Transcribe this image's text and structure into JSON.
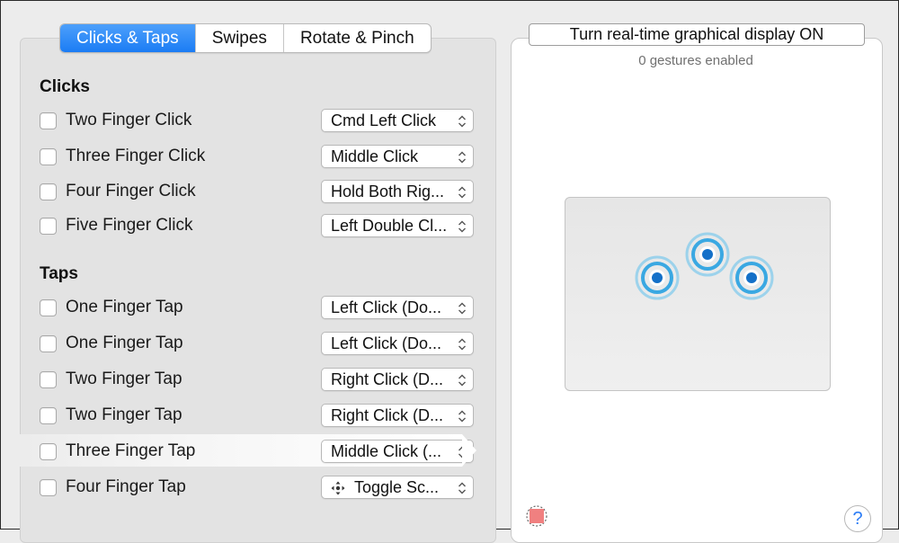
{
  "tabs": [
    {
      "label": "Clicks & Taps",
      "active": true
    },
    {
      "label": "Swipes",
      "active": false
    },
    {
      "label": "Rotate & Pinch",
      "active": false
    }
  ],
  "sections": {
    "clicks_title": "Clicks",
    "taps_title": "Taps"
  },
  "clicks": [
    {
      "label": "Two Finger Click",
      "action": "Cmd Left Click",
      "checked": false
    },
    {
      "label": "Three Finger Click",
      "action": "Middle Click",
      "checked": false
    },
    {
      "label": "Four Finger Click",
      "action": "Hold Both Rig...",
      "checked": false
    },
    {
      "label": "Five Finger Click",
      "action": "Left Double Cl...",
      "checked": false
    }
  ],
  "taps": [
    {
      "label": "One Finger Tap",
      "action": "Left Click (Do...",
      "checked": false
    },
    {
      "label": "One Finger Tap",
      "action": "Left Click (Do...",
      "checked": false
    },
    {
      "label": "Two Finger Tap",
      "action": "Right Click (D...",
      "checked": false
    },
    {
      "label": "Two Finger Tap",
      "action": "Right Click (D...",
      "checked": false
    },
    {
      "label": "Three Finger Tap",
      "action": "Middle Click (...",
      "checked": false,
      "selected": true
    },
    {
      "label": "Four Finger Tap",
      "action": "Toggle Sc...",
      "icon": "move-arrows-icon",
      "checked": false
    }
  ],
  "display_toggle": "Turn real-time graphical display ON",
  "status": "0 gestures enabled",
  "help_label": "?",
  "colors": {
    "accent": "#1b7cf4",
    "touch_ring": "#45b4e8",
    "touch_core": "#1470c8",
    "record": "#f08080"
  }
}
